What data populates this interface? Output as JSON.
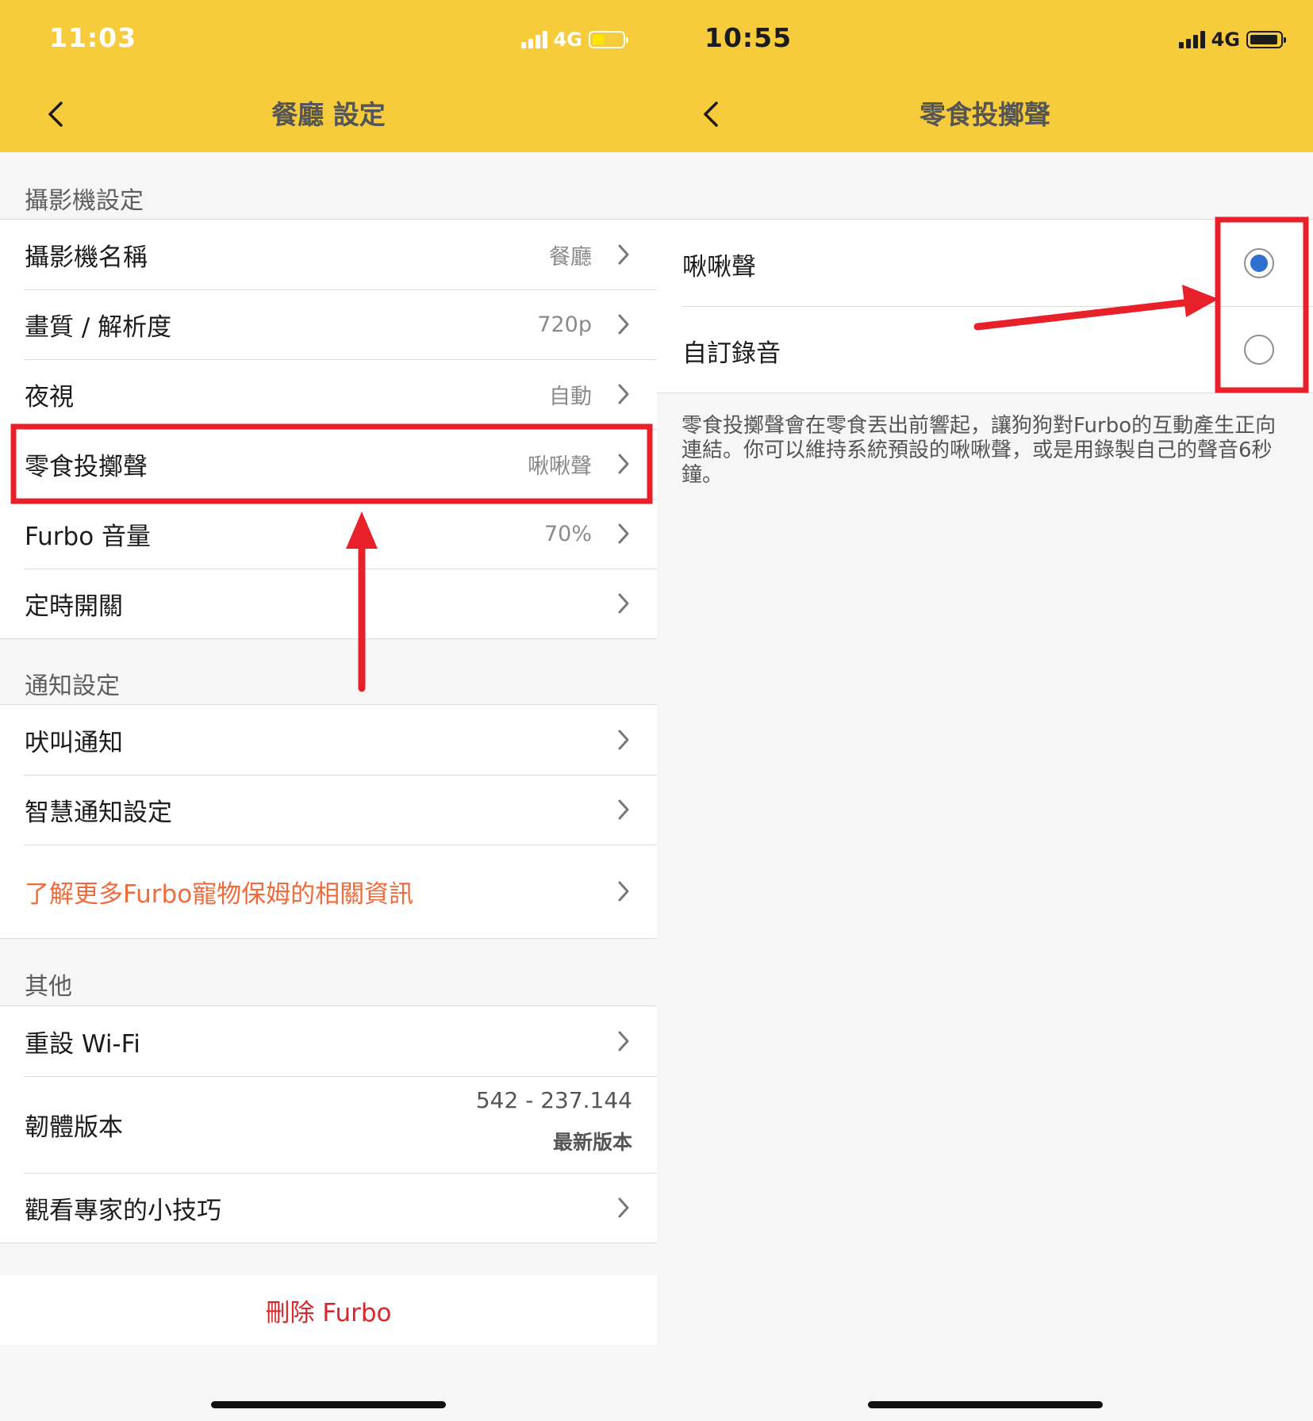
{
  "left_screen": {
    "status": {
      "time": "11:03",
      "network": "4G"
    },
    "title": "餐廳 設定",
    "camera_section": {
      "header": "攝影機設定",
      "items": [
        {
          "label": "攝影機名稱",
          "value": "餐廳"
        },
        {
          "label": "畫質 / 解析度",
          "value": "720p"
        },
        {
          "label": "夜視",
          "value": "自動"
        },
        {
          "label": "零食投擲聲",
          "value": "啾啾聲"
        },
        {
          "label": "Furbo 音量",
          "value": "70%"
        },
        {
          "label": "定時開關",
          "value": ""
        }
      ]
    },
    "notify_section": {
      "header": "通知設定",
      "items": [
        {
          "label": "吠叫通知"
        },
        {
          "label": "智慧通知設定"
        },
        {
          "label": "了解更多Furbo寵物保姆的相關資訊"
        }
      ]
    },
    "other_section": {
      "header": "其他",
      "reset_wifi": "重設 Wi-Fi",
      "firmware": {
        "label": "韌體版本",
        "version": "542 - 237.144",
        "status": "最新版本"
      },
      "tips": "觀看專家的小技巧"
    },
    "delete_label": "刪除 Furbo"
  },
  "right_screen": {
    "status": {
      "time": "10:55",
      "network": "4G"
    },
    "title": "零食投擲聲",
    "options": [
      {
        "label": "啾啾聲",
        "selected": true
      },
      {
        "label": "自訂錄音",
        "selected": false
      }
    ],
    "description": "零食投擲聲會在零食丟出前響起，讓狗狗對Furbo的互動產生正向連結。你可以維持系統預設的啾啾聲，或是用錄製自己的聲音6秒鐘。"
  },
  "colors": {
    "header_bar": "#f6cc3c",
    "annotation_red": "#e8202a",
    "link_orange": "#ef6b3b",
    "delete_red": "#d7272b",
    "radio_selected": "#2f6fd0"
  }
}
